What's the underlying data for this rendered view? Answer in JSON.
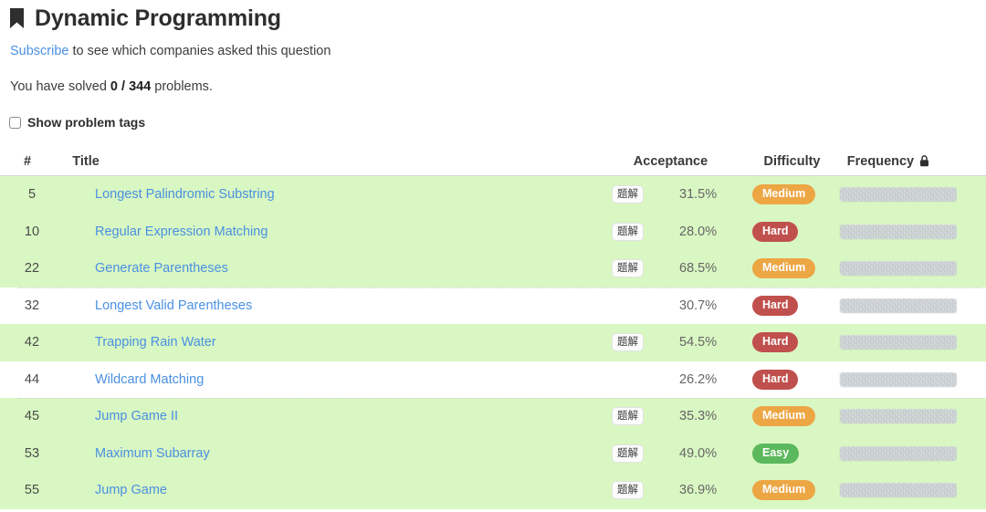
{
  "header": {
    "bookmark_icon": "bookmark-icon",
    "title": "Dynamic Programming",
    "subscribe_link": "Subscribe",
    "subscribe_rest": " to see which companies asked this question",
    "solved_prefix": "You have solved ",
    "solved_count": "0 / 344",
    "solved_suffix": " problems.",
    "show_tags_label": "Show problem tags",
    "show_tags_checked": false
  },
  "table": {
    "columns": {
      "number": "#",
      "title": "Title",
      "acceptance": "Acceptance",
      "difficulty": "Difficulty",
      "frequency": "Frequency",
      "frequency_lock_icon": "lock-icon"
    },
    "solution_badge_label": "题解",
    "rows": [
      {
        "num": "5",
        "title": "Longest Palindromic Substring",
        "solution": "题解",
        "acceptance": "31.5%",
        "difficulty": "Medium",
        "shaded": true,
        "separator": false
      },
      {
        "num": "10",
        "title": "Regular Expression Matching",
        "solution": "题解",
        "acceptance": "28.0%",
        "difficulty": "Hard",
        "shaded": true,
        "separator": false
      },
      {
        "num": "22",
        "title": "Generate Parentheses",
        "solution": "题解",
        "acceptance": "68.5%",
        "difficulty": "Medium",
        "shaded": true,
        "separator": false
      },
      {
        "num": "32",
        "title": "Longest Valid Parentheses",
        "solution": "",
        "acceptance": "30.7%",
        "difficulty": "Hard",
        "shaded": false,
        "separator": true
      },
      {
        "num": "42",
        "title": "Trapping Rain Water",
        "solution": "题解",
        "acceptance": "54.5%",
        "difficulty": "Hard",
        "shaded": true,
        "separator": false
      },
      {
        "num": "44",
        "title": "Wildcard Matching",
        "solution": "",
        "acceptance": "26.2%",
        "difficulty": "Hard",
        "shaded": false,
        "separator": false
      },
      {
        "num": "45",
        "title": "Jump Game II",
        "solution": "题解",
        "acceptance": "35.3%",
        "difficulty": "Medium",
        "shaded": true,
        "separator": true
      },
      {
        "num": "53",
        "title": "Maximum Subarray",
        "solution": "题解",
        "acceptance": "49.0%",
        "difficulty": "Easy",
        "shaded": true,
        "separator": false
      },
      {
        "num": "55",
        "title": "Jump Game",
        "solution": "题解",
        "acceptance": "36.9%",
        "difficulty": "Medium",
        "shaded": true,
        "separator": false
      }
    ]
  },
  "colors": {
    "link": "#4a90e2",
    "row_shaded": "#d9f7c2",
    "easy": "#5cb85c",
    "medium": "#eda644",
    "hard": "#c0504d"
  }
}
